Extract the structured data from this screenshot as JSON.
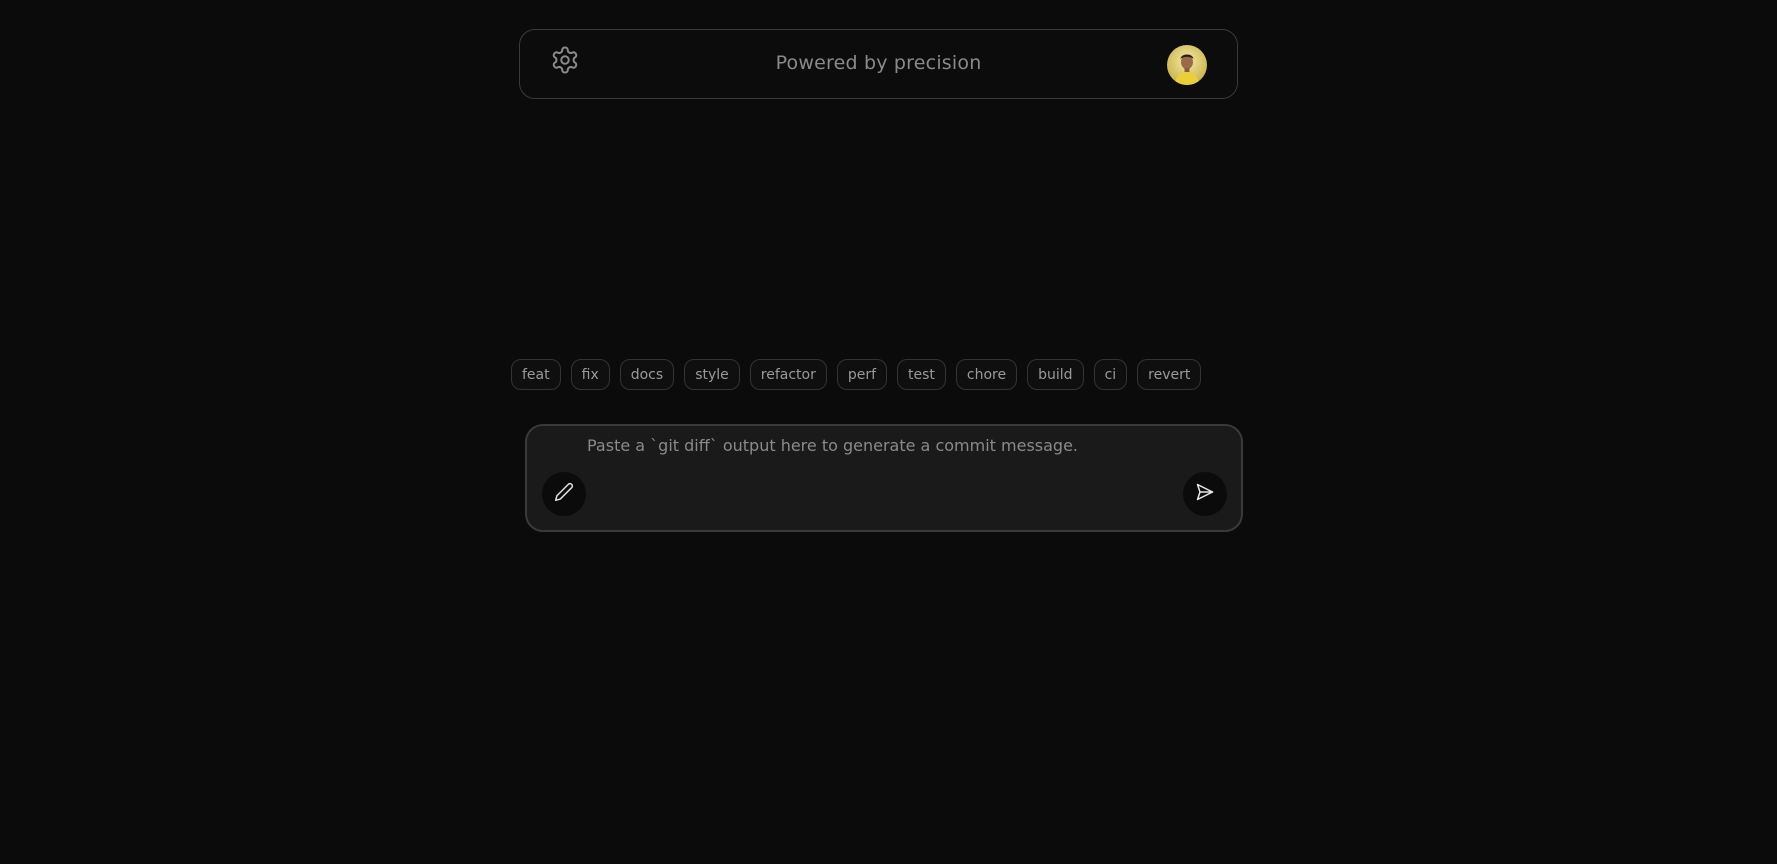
{
  "header": {
    "tagline": "Powered by precision",
    "settings_icon": "gear-icon",
    "avatar_alt": "user-avatar"
  },
  "chips": [
    {
      "label": "feat"
    },
    {
      "label": "fix"
    },
    {
      "label": "docs"
    },
    {
      "label": "style"
    },
    {
      "label": "refactor"
    },
    {
      "label": "perf"
    },
    {
      "label": "test"
    },
    {
      "label": "chore"
    },
    {
      "label": "build"
    },
    {
      "label": "ci"
    },
    {
      "label": "revert"
    }
  ],
  "composer": {
    "value": "",
    "placeholder": "Paste a `git diff` output here to generate a commit message.",
    "left_icon": "pencil-icon",
    "right_icon": "send-icon"
  },
  "colors": {
    "background": "#0b0b0b",
    "composer_bg": "#1a1a1a",
    "border": "#3a3a3a",
    "avatar_bg": "#e8d26a"
  }
}
